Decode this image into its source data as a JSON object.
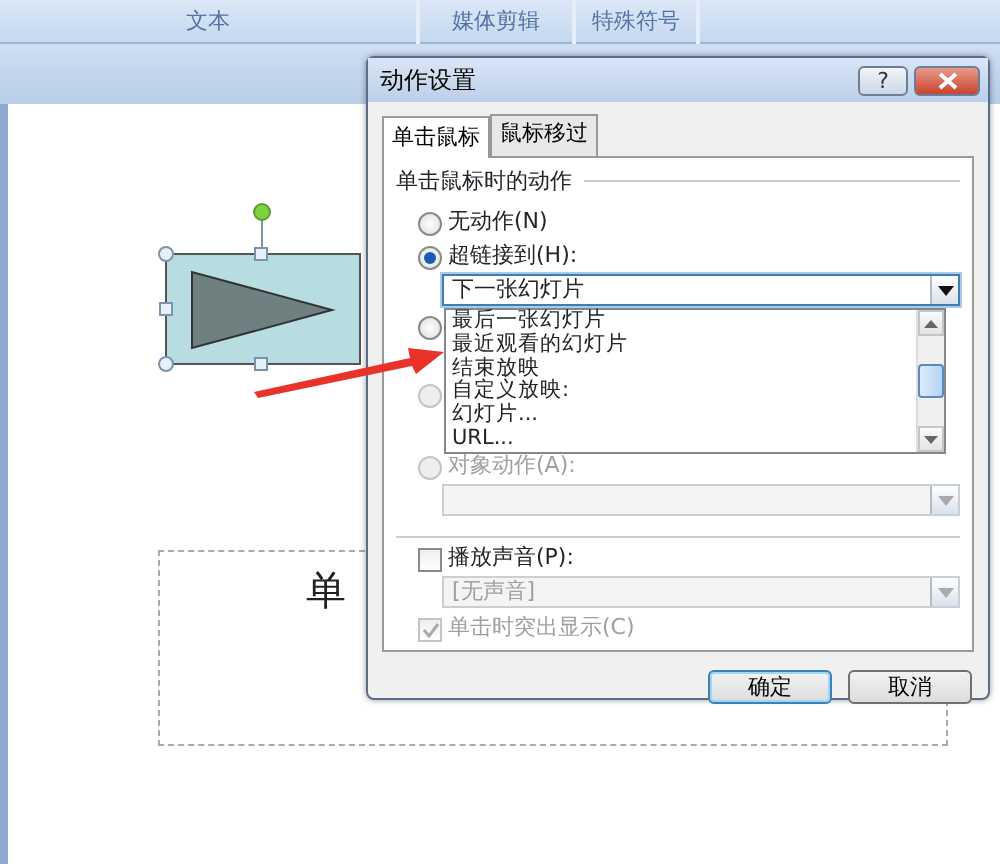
{
  "ribbon": {
    "groups": [
      "文本",
      "媒体剪辑",
      "特殊符号"
    ]
  },
  "slide": {
    "placeholder_text": "单"
  },
  "dialog": {
    "title": "动作设置",
    "help_button": "?",
    "tabs": [
      {
        "label": "单击鼠标",
        "selected": true
      },
      {
        "label": "鼠标移过",
        "selected": false
      }
    ],
    "group_label": "单击鼠标时的动作",
    "actions": [
      {
        "label": "无动作(N)",
        "selected": false,
        "disabled": false
      },
      {
        "label": "超链接到(H):",
        "selected": true,
        "disabled": false
      },
      {
        "selected": false,
        "disabled": false
      },
      {
        "selected": false,
        "disabled": true
      },
      {
        "label": "对象动作(A):",
        "selected": false,
        "disabled": true
      }
    ],
    "hyperlink_dropdown": {
      "value": "下一张幻灯片",
      "expanded": true,
      "options": [
        "最后一张幻灯片",
        "最近观看的幻灯片",
        "结束放映",
        "自定义放映:",
        "幻灯片...",
        "URL..."
      ]
    },
    "play_sound": {
      "label": "播放声音(P):",
      "checked": false
    },
    "sound_dropdown": {
      "value": "[无声音]",
      "disabled": true
    },
    "highlight": {
      "label": "单击时突出显示(C)",
      "checked": true,
      "disabled": true
    },
    "buttons": [
      {
        "label": "确定",
        "default": true
      },
      {
        "label": "取消",
        "default": false
      }
    ]
  }
}
